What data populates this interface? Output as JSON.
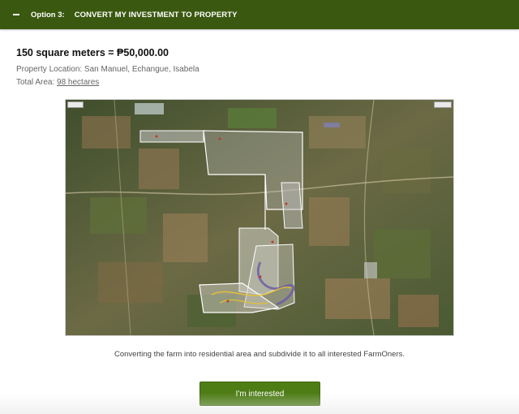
{
  "header": {
    "bullet": "-",
    "option_label": "Option 3:",
    "title": "CONVERT MY INVESTMENT TO PROPERTY"
  },
  "offer": {
    "price_line": "150 square meters = ₱50,000.00",
    "location_line": "Property Location: San Manuel, Echangue, Isabela",
    "area_prefix": "Total Area: ",
    "area_value": "98 hectares"
  },
  "map": {
    "alt": "Satellite map of the farm property with subdivided plots"
  },
  "caption": "Converting the farm into residential area and subdivide it to all interested FarmOners.",
  "cta_label": "I'm interested",
  "colors": {
    "header_bg": "#3b5810",
    "button_bg": "#4e7d16"
  }
}
